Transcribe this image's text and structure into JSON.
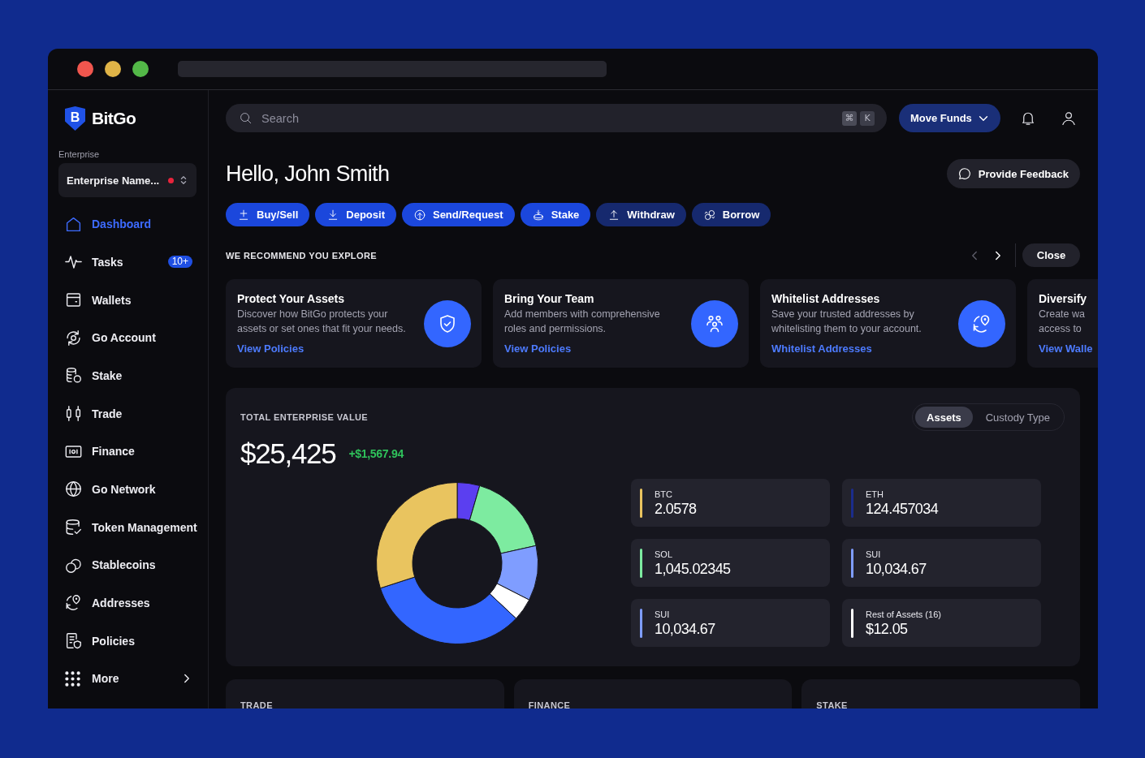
{
  "sidebar": {
    "logo": {
      "mark": "B",
      "name": "BitGo"
    },
    "enterprise": {
      "label": "Enterprise",
      "selector": "Enterprise Name..."
    },
    "items": [
      {
        "label": "Dashboard",
        "kind": "page",
        "selected": true
      },
      {
        "label": "Tasks",
        "kind": "page",
        "selected": false,
        "badge": "10+"
      },
      {
        "label": "Wallets",
        "kind": "page",
        "selected": false
      },
      {
        "label": "Go Account",
        "kind": "page",
        "selected": false
      },
      {
        "label": "Stake",
        "kind": "page",
        "selected": false
      },
      {
        "label": "Trade",
        "kind": "page",
        "selected": false
      },
      {
        "label": "Finance",
        "kind": "page",
        "selected": false
      },
      {
        "label": "Go Network",
        "kind": "page",
        "selected": false
      },
      {
        "label": "Token Management",
        "kind": "page",
        "selected": false
      },
      {
        "label": "Stablecoins",
        "kind": "page",
        "selected": false
      },
      {
        "label": "Addresses",
        "kind": "page",
        "selected": false
      },
      {
        "label": "Policies",
        "kind": "page",
        "selected": false
      },
      {
        "label": "More",
        "kind": "submenu",
        "selected": false
      }
    ]
  },
  "topbar": {
    "search": {
      "placeholder": "Search",
      "shortcut": [
        "⌘",
        "K"
      ]
    },
    "move_funds": "Move Funds"
  },
  "greeting": "Hello, John Smith",
  "feedback_button": "Provide Feedback",
  "actions": [
    {
      "label": "Buy/Sell",
      "kind": "primary"
    },
    {
      "label": "Deposit",
      "kind": "primary"
    },
    {
      "label": "Send/Request",
      "kind": "primary"
    },
    {
      "label": "Stake",
      "kind": "primary"
    },
    {
      "label": "Withdraw",
      "kind": "secondary"
    },
    {
      "label": "Borrow",
      "kind": "secondary"
    }
  ],
  "recommendations": {
    "title": "WE RECOMMEND YOU EXPLORE",
    "previous": {
      "disabled": true
    },
    "next": {
      "disabled": false
    },
    "close": "Close",
    "cards": [
      {
        "title": "Protect Your Assets",
        "description": [
          "Discover how BitGo protects your",
          "assets or set ones that fit your needs."
        ],
        "link": "View Policies"
      },
      {
        "title": "Bring Your Team",
        "description": [
          "Add members with comprehensive",
          "roles and permissions."
        ],
        "link": "View Policies"
      },
      {
        "title": "Whitelist Addresses",
        "description": [
          "Save your trusted addresses by",
          "whitelisting them to your account."
        ],
        "link": "Whitelist Addresses"
      },
      {
        "title": "Diversify",
        "description": [
          "Create wa",
          "access to"
        ],
        "link": "View Walle"
      }
    ]
  },
  "total_value": {
    "title": "TOTAL ENTERPRISE VALUE",
    "view_tabs": [
      {
        "label": "Assets",
        "selected": true
      },
      {
        "label": "Custody Type",
        "selected": false
      }
    ],
    "amount": "$25,425",
    "change": "+$1,567.94",
    "chart_data": {
      "type": "donut",
      "values": [
        4.5,
        17,
        11,
        4.5,
        33,
        30
      ],
      "colors": [
        "#5b3ff0",
        "#7deba0",
        "#7f9dff",
        "#ffffff",
        "#3366ff",
        "#e9c45f"
      ]
    },
    "assets": [
      {
        "symbol": "BTC",
        "amount": "2.0578",
        "color": "#e9c45f"
      },
      {
        "symbol": "ETH",
        "amount": "124.457034",
        "color": "#1b2c8c"
      },
      {
        "symbol": "SOL",
        "amount": "1,045.02345",
        "color": "#7deba0"
      },
      {
        "symbol": "SUI",
        "amount": "10,034.67",
        "color": "#7f9dff"
      },
      {
        "symbol": "SUI",
        "amount": "10,034.67",
        "color": "#7f9dff"
      },
      {
        "symbol": "Rest of Assets (16)",
        "amount": "$12.05",
        "color": "#ffffff"
      }
    ]
  },
  "sections": [
    "TRADE",
    "FINANCE",
    "STAKE"
  ]
}
